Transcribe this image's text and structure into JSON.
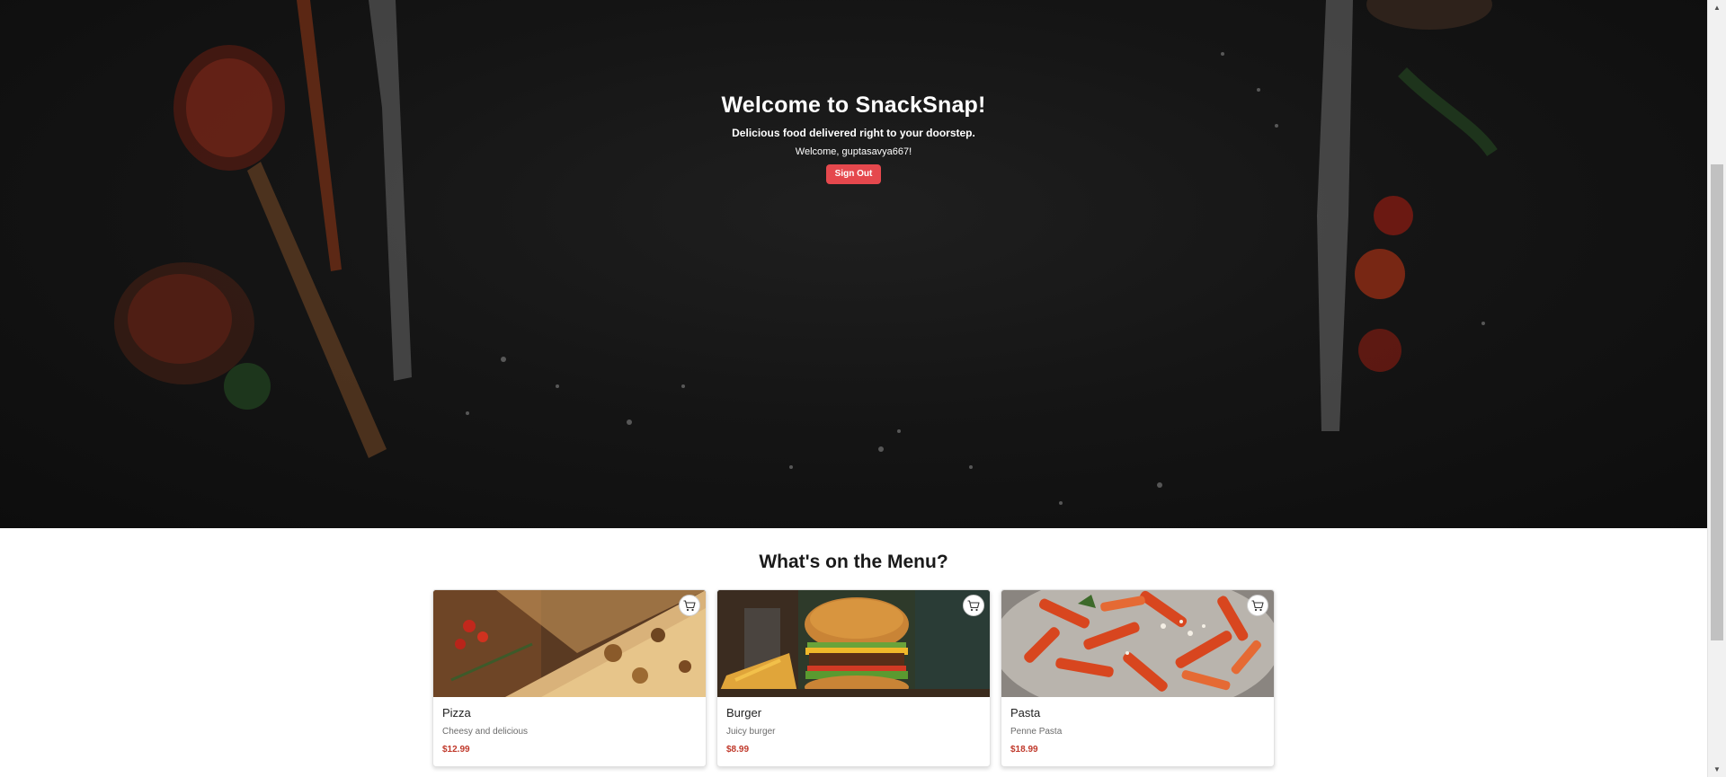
{
  "hero": {
    "title": "Welcome to SnackSnap!",
    "subtitle": "Delicious food delivered right to your doorstep.",
    "welcome_text": "Welcome, guptasavya667!",
    "signout_label": "Sign Out"
  },
  "menu": {
    "heading": "What's on the Menu?",
    "items": [
      {
        "name": "Pizza",
        "description": "Cheesy and delicious",
        "price": "$12.99",
        "icon": "cart-icon"
      },
      {
        "name": "Burger",
        "description": "Juicy burger",
        "price": "$8.99",
        "icon": "cart-icon"
      },
      {
        "name": "Pasta",
        "description": "Penne Pasta",
        "price": "$18.99",
        "icon": "cart-icon"
      }
    ]
  },
  "colors": {
    "accent": "#e5484d",
    "price": "#c0392b",
    "hero_background": "#141414"
  }
}
